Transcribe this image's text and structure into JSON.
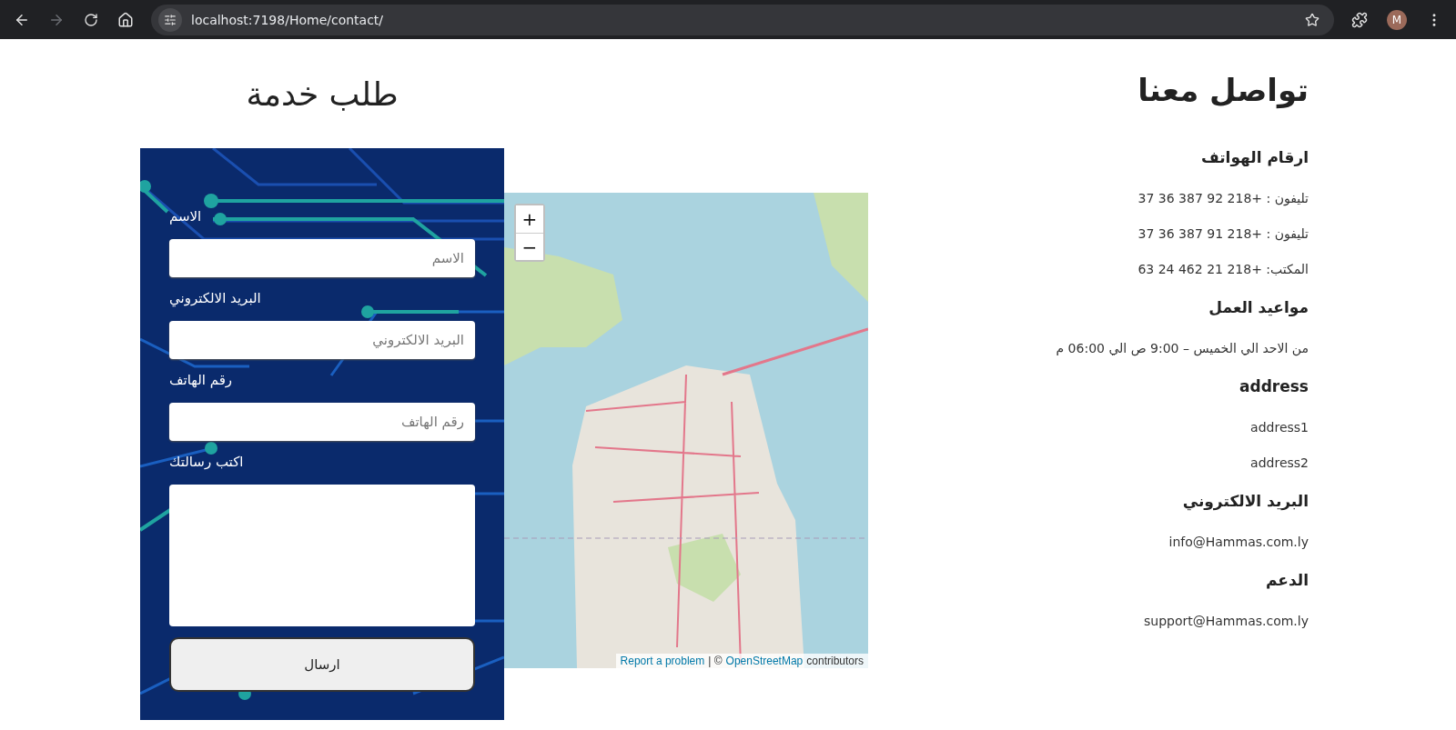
{
  "browser": {
    "url": "localhost:7198/Home/contact/",
    "profile_initial": "M"
  },
  "form": {
    "title": "طلب خدمة",
    "fields": [
      {
        "kind": "input",
        "label": "الاسم",
        "placeholder": "الاسم"
      },
      {
        "kind": "input",
        "label": "البريد الالكتروني",
        "placeholder": "البريد الالكتروني"
      },
      {
        "kind": "input",
        "label": "رقم الهاتف",
        "placeholder": "رقم الهاتف"
      },
      {
        "kind": "textarea",
        "label": "اكتب رسالتك"
      }
    ],
    "submit": "ارسال"
  },
  "map": {
    "zoom_in": "+",
    "zoom_out": "−",
    "attribution": {
      "report_link": "Report a problem",
      "separator": "| ©",
      "osm_link": "OpenStreetMap",
      "suffix": "contributors"
    }
  },
  "contact": {
    "title": "تواصل معنا",
    "sections": [
      {
        "heading": "ارقام الهواتف",
        "lines": [
          "تليفون : +218 92 387 36 37",
          "تليفون : +218 91 387 36 37",
          "المكتب: +218 21 462 24 63"
        ]
      },
      {
        "heading": "مواعيد العمل",
        "lines": [
          "من الاحد الي الخميس – 9:00 ص الي 06:00 م"
        ]
      },
      {
        "heading": "address",
        "lines": [
          "address1",
          "address2"
        ]
      },
      {
        "heading": "البريد الالكتروني",
        "lines": [
          "info@Hammas.com.ly"
        ]
      },
      {
        "heading": "الدعم",
        "lines": [
          "support@Hammas.com.ly"
        ]
      }
    ]
  }
}
